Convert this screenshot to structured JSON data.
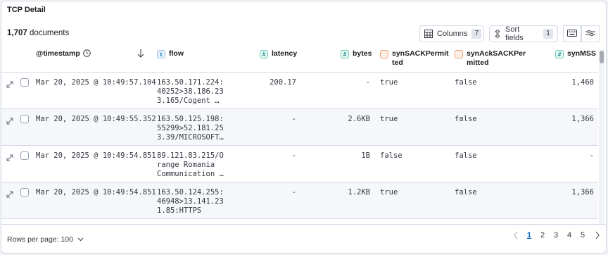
{
  "panel": {
    "title": "TCP Detail"
  },
  "toolbar": {
    "doc_count": "1,707",
    "doc_label": "documents",
    "columns_label": "Columns",
    "columns_count": "7",
    "sort_label": "Sort fields",
    "sort_count": "1"
  },
  "columns": [
    {
      "label": "@timestamp",
      "type": ""
    },
    {
      "label": "flow",
      "type": "t"
    },
    {
      "label": "latency",
      "type": "#"
    },
    {
      "label": "bytes",
      "type": "#"
    },
    {
      "label": "synSACKPermit\nted",
      "type": "b"
    },
    {
      "label": "synAckSACKPer\nmitted",
      "type": "b"
    },
    {
      "label": "synMSS",
      "type": "#"
    }
  ],
  "rows": [
    {
      "timestamp": "Mar 20, 2025 @ 10:49:57.104",
      "flow": "163.50.171.224:\n40252>38.186.23\n3.165/Cogent …",
      "latency": "200.17",
      "bytes": "-",
      "synSACKPermitted": "true",
      "synAckSACKPermitted": "false",
      "synMSS": "1,460"
    },
    {
      "timestamp": "Mar 20, 2025 @ 10:49:55.352",
      "flow": "163.50.125.198:\n55299>52.181.25\n3.39/MICROSOFT…",
      "latency": "-",
      "bytes": "2.6KB",
      "synSACKPermitted": "true",
      "synAckSACKPermitted": "false",
      "synMSS": "1,366"
    },
    {
      "timestamp": "Mar 20, 2025 @ 10:49:54.851",
      "flow": "89.121.83.215/O\nrange Romania\nCommunication …",
      "latency": "-",
      "bytes": "1B",
      "synSACKPermitted": "false",
      "synAckSACKPermitted": "false",
      "synMSS": "-"
    },
    {
      "timestamp": "Mar 20, 2025 @ 10:49:54.851",
      "flow": "163.50.124.255:\n46948>13.141.23\n1.85:HTTPS",
      "latency": "-",
      "bytes": "1.2KB",
      "synSACKPermitted": "true",
      "synAckSACKPermitted": "false",
      "synMSS": "1,366"
    }
  ],
  "footer": {
    "rows_per_page": "Rows per page: 100",
    "pages": [
      "1",
      "2",
      "3",
      "4",
      "5"
    ],
    "active_page": "1"
  },
  "colors": {
    "accent": "#0061c2",
    "border": "#d3dae6",
    "text": "#343741"
  }
}
